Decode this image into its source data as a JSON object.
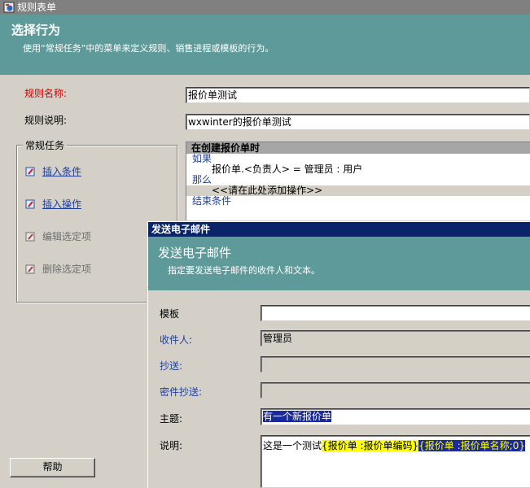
{
  "window": {
    "title": "规则表单"
  },
  "header": {
    "title": "选择行为",
    "description": "使用“常规任务”中的菜单来定义规则、销售进程或模板的行为。"
  },
  "form": {
    "rule_name_label": "规则名称:",
    "rule_name_value": "报价单测试",
    "rule_desc_label": "规则说明:",
    "rule_desc_value": "wxwinter的报价单测试"
  },
  "tasks": {
    "legend": "常规任务",
    "items": [
      {
        "label": "插入条件",
        "enabled": true
      },
      {
        "label": "插入操作",
        "enabled": true
      },
      {
        "label": "编辑选定项",
        "enabled": false
      },
      {
        "label": "删除选定项",
        "enabled": false
      }
    ]
  },
  "rule": {
    "heading": "在创建报价单时",
    "if": "如果",
    "condition": "报价单.<负责人> = 管理员 : 用户",
    "then": "那么",
    "placeholder": "<<请在此处添加操作>>",
    "end": "结束条件"
  },
  "help_button": "帮助",
  "dialog": {
    "title": "发送电子邮件",
    "header_title": "发送电子邮件",
    "header_desc": "指定要发送电子邮件的收件人和文本。",
    "template_label": "模板",
    "template_value": "",
    "to_label": "收件人:",
    "to_value": "管理员",
    "cc_label": "抄送:",
    "cc_value": "",
    "bcc_label": "密件抄送:",
    "bcc_value": "",
    "subject_label": "主题:",
    "subject_value": "有一个新报价单",
    "body_label": "说明:",
    "body_text": "这是一个测试",
    "body_tag1": "{报价单 :报价单编码}",
    "body_tag2": "{报价单 :报价单名称;0}"
  },
  "colors": {
    "header_band": "#5f9a9a",
    "dialog_titlebar": "#0a246a",
    "required_label": "#cc0000",
    "link": "#1f3f99"
  }
}
